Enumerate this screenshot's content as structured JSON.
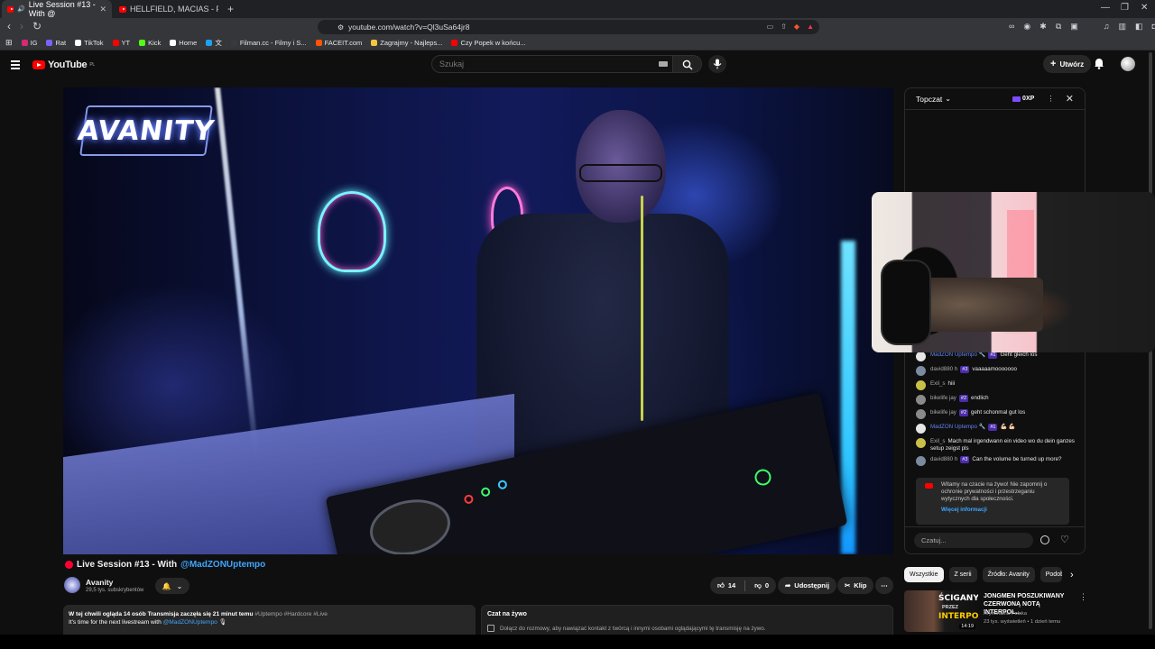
{
  "browser": {
    "tabs": [
      {
        "title": "Live Session #13 - With @",
        "active": true
      },
      {
        "title": "HELLFIELD, MACIAS - Fendi RMX (OFF",
        "active": false
      }
    ],
    "url": "youtube.com/watch?v=Ql3uSa64jr8",
    "bookmarks": [
      {
        "label": "IG",
        "color": "#d62976"
      },
      {
        "label": "Rat",
        "color": "#7b61ff"
      },
      {
        "label": "TikTok",
        "color": "#ffffff"
      },
      {
        "label": "YT",
        "color": "#ff0000"
      },
      {
        "label": "Kick",
        "color": "#53fc18"
      },
      {
        "label": "Home",
        "color": "#ffffff"
      },
      {
        "label": "",
        "color": "#1da1f2"
      },
      {
        "label": "Filman.cc - Filmy i S...",
        "color": "#3a3a3a"
      },
      {
        "label": "FACEIT.com",
        "color": "#ff5500"
      },
      {
        "label": "Zagrajmy - Najleps...",
        "color": "#f5c542"
      },
      {
        "label": "Czy Popek w końcu...",
        "color": "#ff0000"
      }
    ]
  },
  "youtube": {
    "logo_text": "YouTube",
    "logo_region": "PL",
    "search_placeholder": "Szukaj",
    "create_label": "Utwórz"
  },
  "video": {
    "overlay_logo": "AVANITY",
    "title_prefix": "Live Session #13 - With",
    "title_mention": "@MadZONUptempo",
    "live_color": "#ff0033"
  },
  "channel": {
    "name": "Avanity",
    "subscribers": "29,5 tys. subskrybentów"
  },
  "actions": {
    "likes": "14",
    "dislikes": "0",
    "share": "Udostępnij",
    "clip": "Klip"
  },
  "description": {
    "stats": "W tej chwili ogląda 14 osób  Transmisja zaczęła się 21 minut temu",
    "tags": "#Uptempo #Hardcore #Live",
    "line2_prefix": "It's time for the next livestream with",
    "line2_mention": "@MadZONUptempo",
    "line2_suffix": "🎙"
  },
  "live_chat_box": {
    "title": "Czat na żywo",
    "text": "Dołącz do rozmowy, aby nawiązać kontakt z twórcą i innymi osobami oglądającymi tę transmisję na żywo."
  },
  "chat": {
    "mode": "Topczat",
    "xp": "0XP",
    "messages": [
      {
        "author": "MadZON Uptempo 🔧",
        "mod": true,
        "rank": "#1",
        "text": "Geht gleich los",
        "color": "#e6e6e6"
      },
      {
        "author": "david880 h",
        "mod": false,
        "rank": "#3",
        "text": "vaaaaamooooooo",
        "color": "#7c8aa0"
      },
      {
        "author": "Exil_s",
        "mod": false,
        "rank": "",
        "text": "hiii",
        "color": "#c9c04a"
      },
      {
        "author": "bikelife jay",
        "mod": false,
        "rank": "#2",
        "text": "endlich",
        "color": "#8a8a8a"
      },
      {
        "author": "bikelife jay",
        "mod": false,
        "rank": "#2",
        "text": "geht schonmal gut los",
        "color": "#8a8a8a"
      },
      {
        "author": "MadZON Uptempo 🔧",
        "mod": true,
        "rank": "#1",
        "text": "💪🏻 💪🏻",
        "color": "#e6e6e6"
      },
      {
        "author": "Exil_s",
        "mod": false,
        "rank": "",
        "text": "Mach mal irgendwann ein video wo du dein ganzes setup zeigst pls",
        "color": "#c9c04a"
      },
      {
        "author": "david880 h",
        "mod": false,
        "rank": "#3",
        "text": "Can the volume be turned up more?",
        "color": "#7c8aa0"
      }
    ],
    "notice_text": "Witamy na czacie na żywo! Nie zapomnij o ochronie prywatności i przestrzeganiu wytycznych dla społeczności.",
    "notice_more": "Więcej informacji",
    "input_placeholder": "Czatuj..."
  },
  "chips": [
    "Wszystkie",
    "Z serii",
    "Źródło: Avanity",
    "Podob"
  ],
  "recommendation": {
    "thumb_line1": "ŚCIGANY",
    "thumb_line2": "PRZEZ",
    "thumb_line3": "INTERPOL",
    "duration": "14:19",
    "title": "JONGMEN POSZUKIWANY CZERWONĄ NOTĄ INTERPOL...",
    "channel": "Kryminalna Polska",
    "meta": "23 tys. wyświetleń • 1 dzień temu"
  }
}
